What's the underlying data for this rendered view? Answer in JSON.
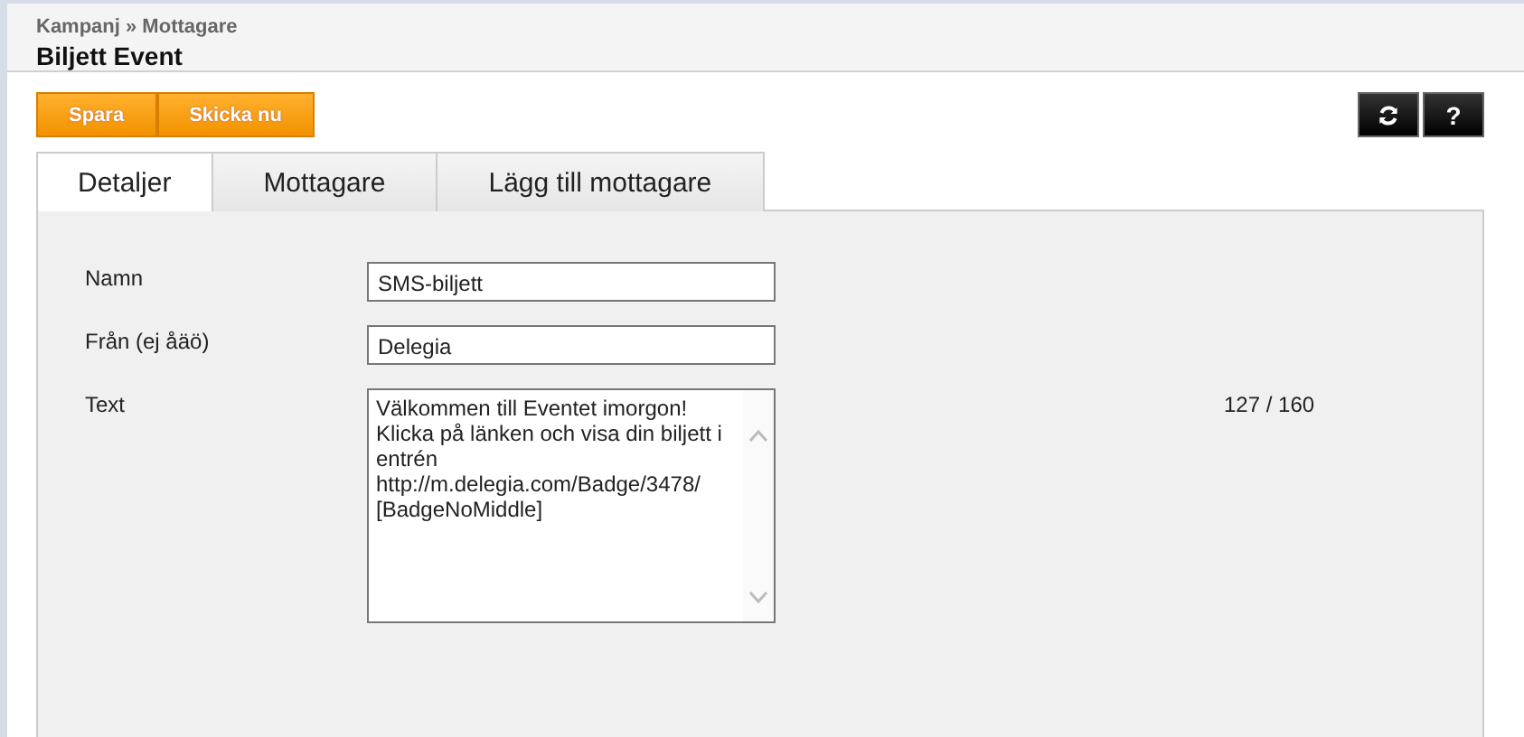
{
  "breadcrumb": "Kampanj » Mottagare",
  "title": "Biljett Event",
  "actions": [
    "Spara",
    "Skicka nu"
  ],
  "tool_buttons": [
    {
      "kind": "refresh"
    },
    {
      "kind": "help",
      "label": "?"
    }
  ],
  "tabs": [
    {
      "label": "Detaljer",
      "selected": true
    },
    {
      "label": "Mottagare",
      "selected": false
    },
    {
      "label": "Lägg till mottagare",
      "selected": false
    }
  ],
  "fields": [
    {
      "label": "Namn",
      "kind": "input",
      "value": "SMS-biljett"
    },
    {
      "label": "Från (ej åäö)",
      "kind": "input",
      "value": "Delegia"
    },
    {
      "label": "Text",
      "kind": "textarea",
      "lines": [
        "Välkommen till Eventet imorgon!",
        "Klicka på länken och visa din biljett i",
        "entrén",
        "http://m.delegia.com/Badge/3478/",
        "[BadgeNoMiddle]"
      ],
      "counter": "127 / 160"
    }
  ]
}
